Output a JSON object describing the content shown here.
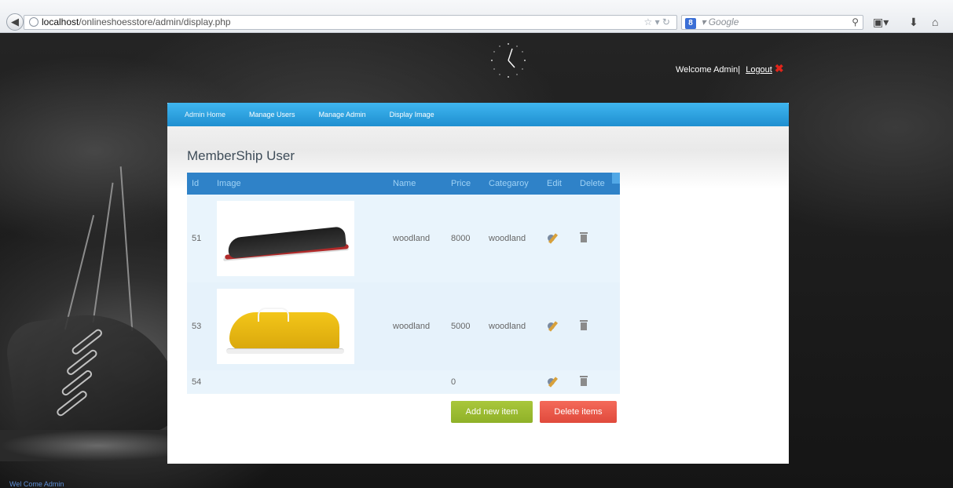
{
  "browser": {
    "url_host": "localhost",
    "url_path": "/onlineshoesstore/admin/display.php",
    "search_engine": "Google",
    "search_placeholder": "Google"
  },
  "header": {
    "welcome_text": "Welcome Admin|",
    "logout_label": "Logout"
  },
  "nav": {
    "items": [
      {
        "label": "Admin Home"
      },
      {
        "label": "Manage Users"
      },
      {
        "label": "Manage Admin"
      },
      {
        "label": "Display Image"
      }
    ]
  },
  "panel": {
    "title": "MemberShip User"
  },
  "table": {
    "headers": [
      "Id",
      "Image",
      "Name",
      "Price",
      "Categaroy",
      "Edit",
      "Delete"
    ],
    "rows": [
      {
        "id": "51",
        "name": "woodland",
        "price": "8000",
        "category": "woodland",
        "image": "black-sports-shoe"
      },
      {
        "id": "53",
        "name": "woodland",
        "price": "5000",
        "category": "woodland",
        "image": "yellow-casual-shoe"
      },
      {
        "id": "54",
        "name": "",
        "price": "0",
        "category": "",
        "image": ""
      }
    ]
  },
  "actions": {
    "add_label": "Add new item",
    "delete_label": "Delete items"
  },
  "status": {
    "text": "Wel Come Admin"
  },
  "colors": {
    "nav_blue": "#2a9fe0",
    "table_header": "#2f82c8",
    "add_green": "#9cbd32",
    "delete_red": "#ec5a4b",
    "logout_x": "#e0251b"
  }
}
